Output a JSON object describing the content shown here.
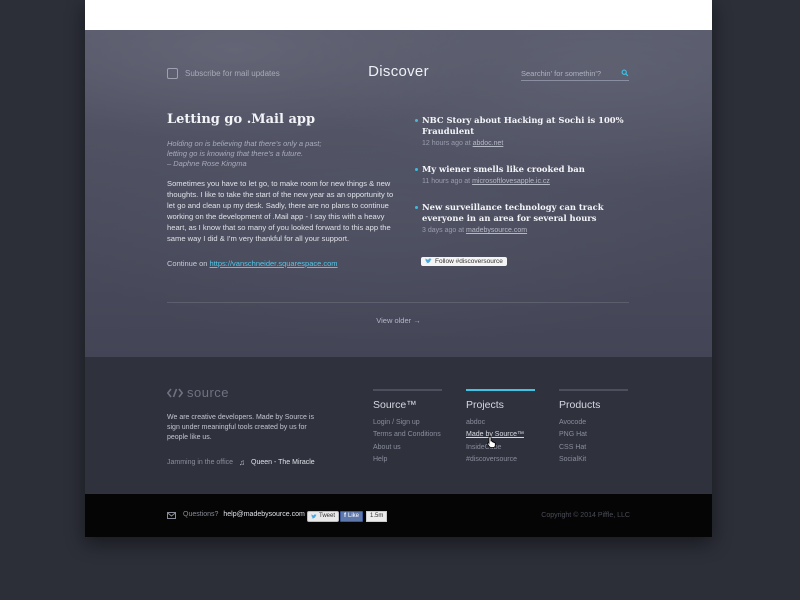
{
  "hero": {
    "subscribe_label": "Subscribe for mail updates",
    "title": "Discover",
    "search_placeholder": "Searchin' for somethin'?",
    "view_older": "View older →"
  },
  "article": {
    "title": "Letting go .Mail app",
    "quote_lines": [
      "Holding on is believing that there's only a past;",
      "letting go is knowing that there's a future.",
      "– Daphne Rose Kingma"
    ],
    "body": "Sometimes you have to let go, to make room for new things & new thoughts. I like to take the start of the new year as an opportunity to let go and clean up my desk. Sadly, there are no plans to continue working on the development of .Mail app - I say this with a heavy heart, as I know that so many of you looked forward to this app the same way I did & I'm very thankful for all your support.",
    "continue_prefix": "Continue on",
    "continue_link": "https://vanschneider.squarespace.com"
  },
  "news": [
    {
      "title": "NBC Story about Hacking at Sochi is 100% Fraudulent",
      "time": "12 hours ago at",
      "source": "abdoc.net"
    },
    {
      "title": "My wiener smells like crooked ban",
      "time": "11 hours ago at",
      "source": "microsoftlovesapple.ic.cz"
    },
    {
      "title": "New surveillance technology can track everyone in an area for several hours",
      "time": "3 days ago at",
      "source": "madebysource.com"
    }
  ],
  "follow_label": "Follow #discoversource",
  "footer": {
    "logo_text": "source",
    "about": "We are creative developers. Made by Source is sign under meaningful tools created by us for people like us.",
    "jamming_label": "Jamming in the office",
    "song": "Queen - The Miracle",
    "columns": [
      {
        "title": "Source™",
        "links": [
          "Login / Sign up",
          "Terms and Conditions",
          "About us",
          "Help"
        ]
      },
      {
        "title": "Projects",
        "links": [
          "abdoc",
          "Made by Source™",
          "InsideCube",
          "#discoversource"
        ]
      },
      {
        "title": "Products",
        "links": [
          "Avocode",
          "PNG Hat",
          "CSS Hat",
          "SocialKit"
        ]
      }
    ]
  },
  "bottom": {
    "questions_label": "Questions?",
    "email": "help@madebysource.com",
    "tweet_label": "Tweet",
    "like_label": "Like",
    "like_count": "1.5m",
    "copyright": "Copyright © 2014 Piffle, LLC"
  },
  "colors": {
    "accent": "#3ec4e4",
    "link": "#52c5e6",
    "footer_bg": "#2f313d",
    "bottom_bg": "#050505"
  },
  "icons": [
    "checkbox-icon",
    "search-icon",
    "twitter-icon",
    "source-logo-icon",
    "music-note-icon",
    "mail-icon",
    "facebook-icon",
    "hand-cursor-icon"
  ]
}
